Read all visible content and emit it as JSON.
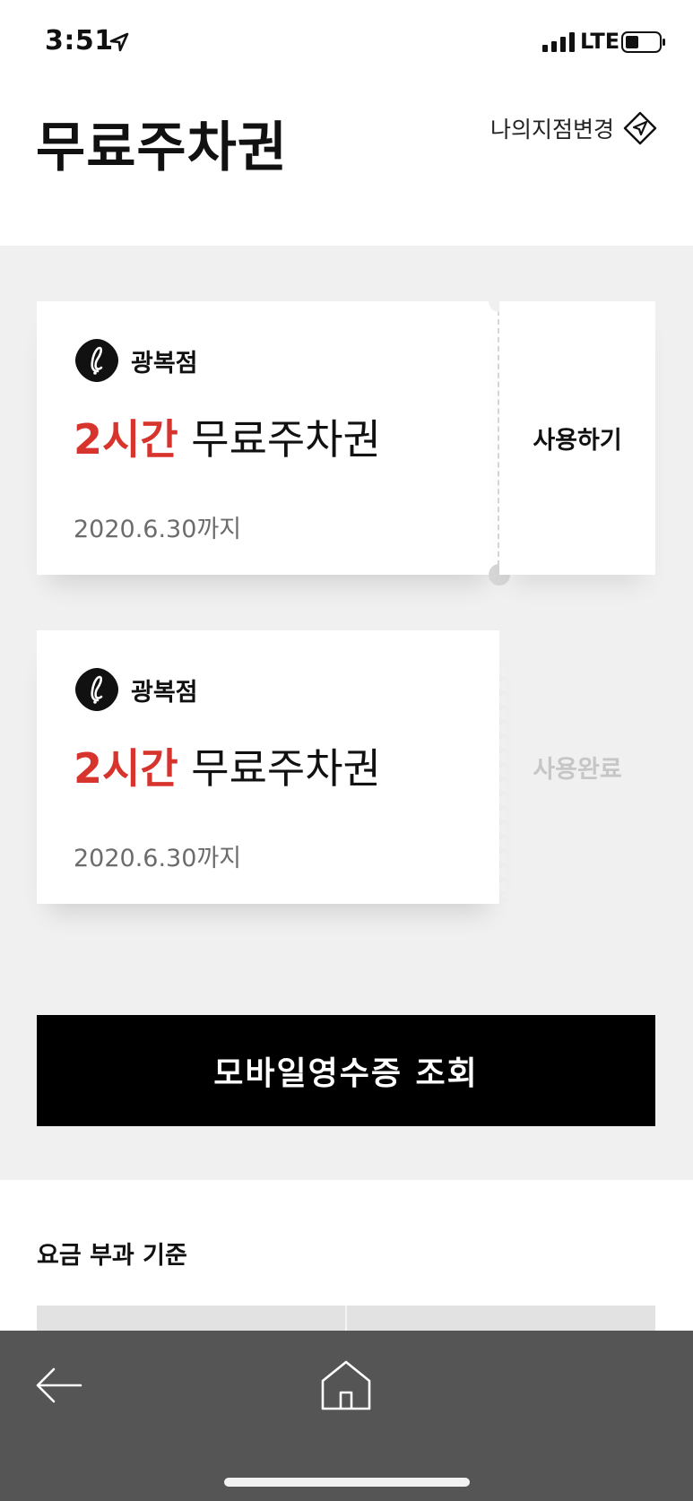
{
  "status_bar": {
    "time": "3:51",
    "network": "LTE"
  },
  "header": {
    "title": "무료주차권",
    "branch_change_label": "나의지점변경"
  },
  "coupons": [
    {
      "branch": "광복점",
      "hours": "2시간",
      "type": "무료주차권",
      "expiry": "2020.6.30까지",
      "action": "사용하기",
      "status": "active"
    },
    {
      "branch": "광복점",
      "hours": "2시간",
      "type": "무료주차권",
      "expiry": "2020.6.30까지",
      "action": "사용완료",
      "status": "used"
    }
  ],
  "receipt_button": "모바일영수증 조회",
  "fee_section": {
    "title": "요금 부과 기준"
  },
  "colors": {
    "accent_red": "#d8342e",
    "used_gray": "#c6c6c6",
    "section_bg": "#f0f0f0",
    "bottom_bar": "#555555"
  },
  "icons": {
    "back": "arrow-left-icon",
    "home": "home-icon",
    "branch": "navigation-icon",
    "brand": "lotte-logo-icon"
  }
}
